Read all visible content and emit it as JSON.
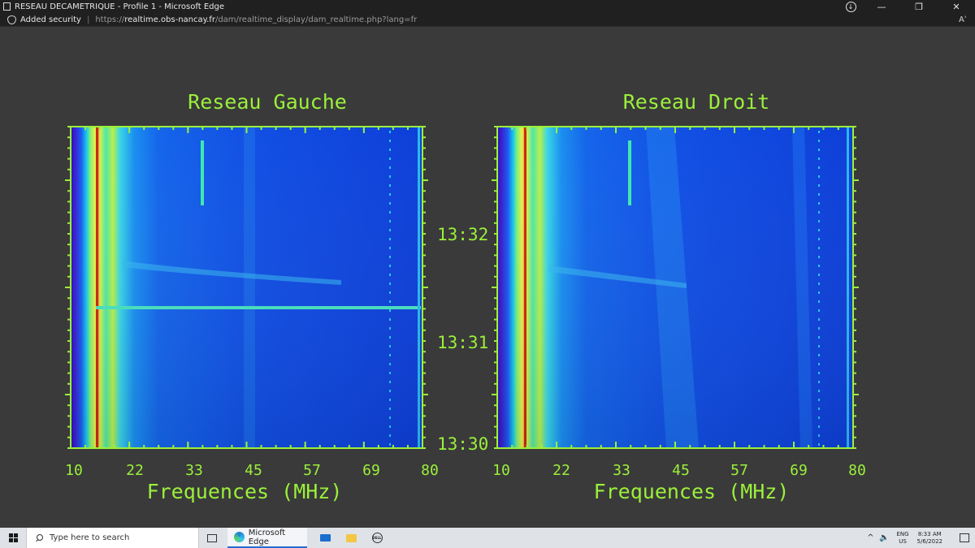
{
  "window": {
    "title": "RESEAU DECAMETRIQUE - Profile 1 - Microsoft Edge",
    "minimize_icon": "—",
    "restore_icon": "❐",
    "close_icon": "✕"
  },
  "addressbar": {
    "security_label": "Added security",
    "url_prefix": "https://",
    "url_domain": "realtime.obs-nancay.fr",
    "url_path": "/dam/realtime_display/dam_realtime.php?lang=fr",
    "read_aloud": "Aʾ"
  },
  "spectrograms": {
    "left_title": "Reseau Gauche",
    "right_title": "Reseau Droit",
    "x_ticks": [
      "10",
      "22",
      "33",
      "45",
      "57",
      "69",
      "80"
    ],
    "xlabel": "Frequences (MHz)",
    "time_ticks": [
      "13:32",
      "13:31",
      "13:30"
    ],
    "colors": {
      "axis": "#9bf03a",
      "background": "#0a3fd8"
    }
  },
  "taskbar": {
    "search_placeholder": "Type here to search",
    "edge_label": "Microsoft Edge",
    "dell_label": "DELL",
    "chevron": "^",
    "speaker": "🔈",
    "lang_line1": "ENG",
    "lang_line2": "US",
    "time": "8:33 AM",
    "date": "5/6/2022"
  }
}
